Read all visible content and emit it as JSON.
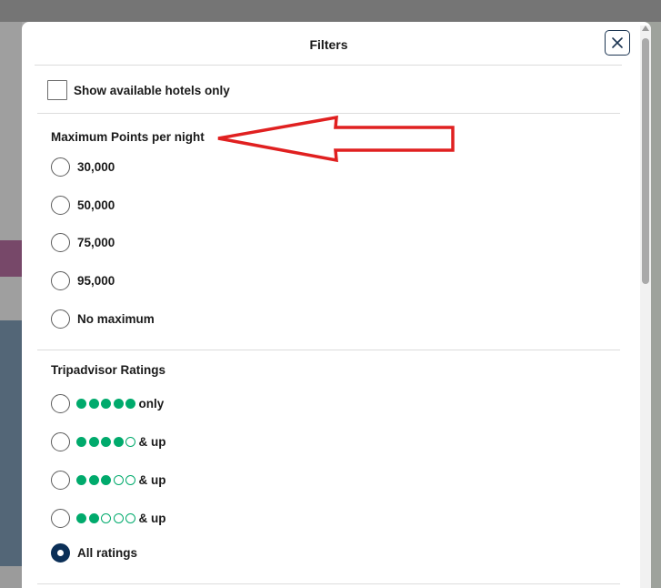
{
  "modal": {
    "title": "Filters",
    "close_icon": "close-icon"
  },
  "availability": {
    "label": "Show available hotels only",
    "checked": false
  },
  "points_section": {
    "title": "Maximum Points per night",
    "options": [
      {
        "label": "30,000",
        "selected": false
      },
      {
        "label": "50,000",
        "selected": false
      },
      {
        "label": "75,000",
        "selected": false
      },
      {
        "label": "95,000",
        "selected": false
      },
      {
        "label": "No maximum",
        "selected": false
      }
    ]
  },
  "ratings_section": {
    "title": "Tripadvisor Ratings",
    "bubble_color": "#00aa6c",
    "options": [
      {
        "filled_bubbles": 5,
        "suffix": "only",
        "selected": false
      },
      {
        "filled_bubbles": 4,
        "suffix": "& up",
        "selected": false
      },
      {
        "filled_bubbles": 3,
        "suffix": "& up",
        "selected": false
      },
      {
        "filled_bubbles": 2,
        "suffix": "& up",
        "selected": false
      },
      {
        "label": "All ratings",
        "selected": true
      }
    ]
  },
  "annotation": {
    "arrow_color": "#e02020",
    "icon": "red-arrow-annotation"
  },
  "colors": {
    "selected_radio": "#0b2f57",
    "close_border": "#1c3552"
  }
}
